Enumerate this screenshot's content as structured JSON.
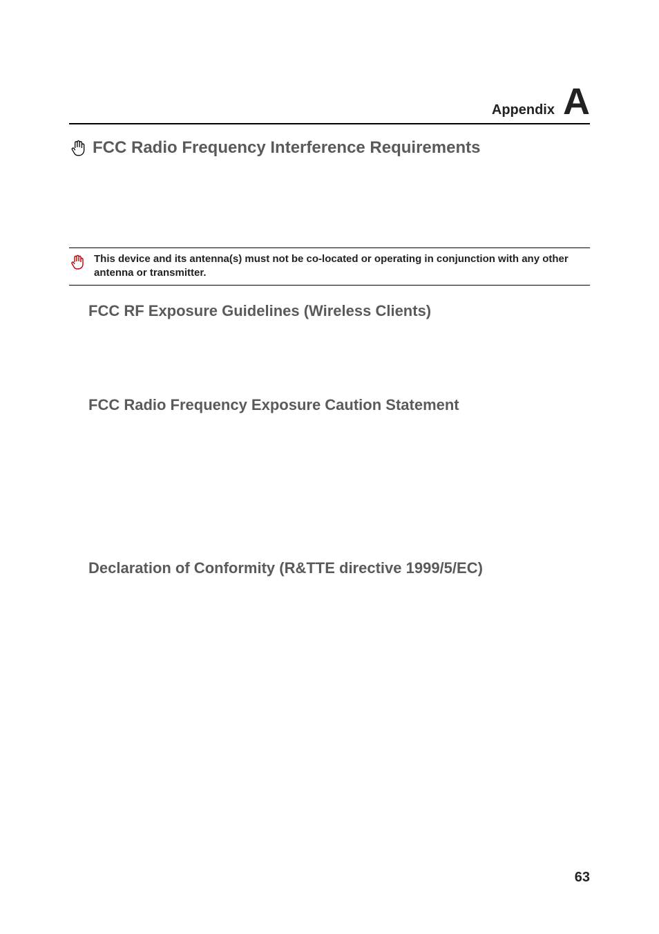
{
  "appendix": {
    "label": "Appendix",
    "letter": "A"
  },
  "section": {
    "icon": "hand-icon",
    "title": "FCC Radio Frequency Interference Requirements"
  },
  "note": {
    "icon": "important-icon",
    "text": "This device and its antenna(s) must not be co-located or operating in conjunction with any other antenna or transmitter."
  },
  "subsections": [
    {
      "title": "FCC RF Exposure Guidelines (Wireless Clients)"
    },
    {
      "title": "FCC Radio Frequency Exposure Caution Statement"
    },
    {
      "title": "Declaration of Conformity (R&TTE directive 1999/5/EC)"
    }
  ],
  "page_number": "63"
}
